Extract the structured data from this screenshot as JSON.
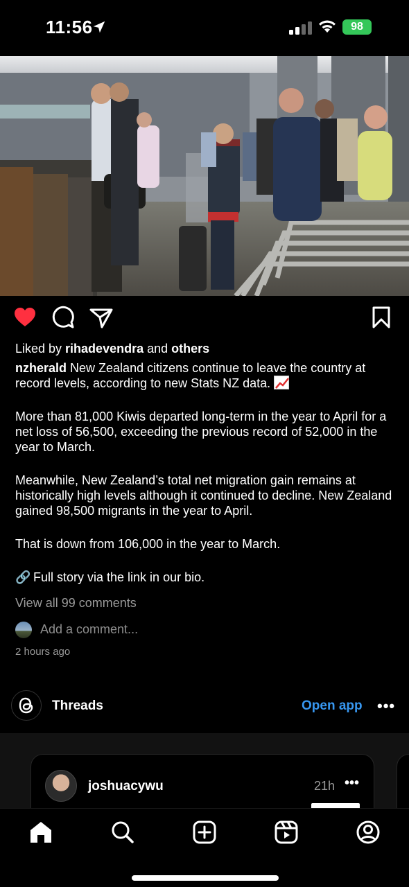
{
  "status_bar": {
    "time": "11:56",
    "battery": "98",
    "icons": [
      "location-arrow-icon",
      "signal-icon",
      "wifi-icon",
      "battery-icon"
    ]
  },
  "post": {
    "photo_icon": "airport-departures-photo",
    "actions": [
      "heart-icon",
      "comment-icon",
      "share-icon",
      "bookmark-icon"
    ],
    "like_color": "#ff3040",
    "likes": {
      "prefix": "Liked by ",
      "user": "rihadevendra",
      "middle": " and ",
      "others": "others"
    },
    "caption": {
      "username": "nzherald",
      "p1": "New Zealand citizens continue to leave the country at record levels, according to new Stats NZ data.",
      "p1_emoji": "chart-increasing-emoji",
      "p2": "More than 81,000 Kiwis departed long-term in the year to April for a net loss of 56,500, exceeding the previous record of 52,000 in the year to March.",
      "p3": "Meanwhile, New Zealand’s total net migration gain remains at historically high levels although it continued to decline. New Zealand gained 98,500 migrants in the year to April.",
      "p4": "That is down from 106,000 in the year to March.",
      "p5_emoji": "🔗",
      "p5": "Full story via the link in our bio."
    },
    "view_comments": "View all 99 comments",
    "add_comment_placeholder": "Add a comment...",
    "timestamp": "2 hours ago"
  },
  "threads": {
    "label": "Threads",
    "open_app": "Open app",
    "more": "•••",
    "accent": "#3797f0",
    "card": {
      "username": "joshuacywu",
      "time": "21h",
      "more": "•••"
    }
  },
  "tab_bar": {
    "tabs": [
      "home-icon",
      "search-icon",
      "create-icon",
      "reels-icon",
      "profile-icon"
    ]
  }
}
